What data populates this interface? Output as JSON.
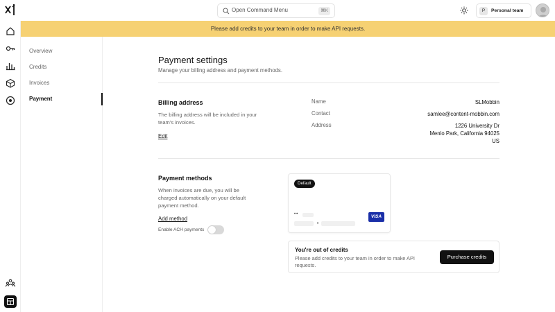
{
  "topbar": {
    "command_menu_placeholder": "Open Command Menu",
    "command_menu_shortcut": "⌘K",
    "team_initial": "P",
    "team_name": "Personal team"
  },
  "banner": {
    "text": "Please add credits to your team in order to make API requests.",
    "color": "#f6d173"
  },
  "rail": {
    "icons": [
      "home-icon",
      "key-icon",
      "bar-chart-icon",
      "cube-icon",
      "target-icon",
      "team-icon",
      "panel-icon"
    ]
  },
  "subnav": {
    "items": [
      {
        "label": "Overview",
        "active": false
      },
      {
        "label": "Credits",
        "active": false
      },
      {
        "label": "Invoices",
        "active": false
      },
      {
        "label": "Payment",
        "active": true
      }
    ]
  },
  "main": {
    "title": "Payment settings",
    "subtitle": "Manage your billing address and payment methods.",
    "billing": {
      "title": "Billing address",
      "description": "The billing address will be included in your team's invoices.",
      "edit_label": "Edit",
      "name_label": "Name",
      "name_value": "SLMobbin",
      "contact_label": "Contact",
      "contact_value": "samlee@content-mobbin.com",
      "address_label": "Address",
      "address_line1": "1226 University Dr",
      "address_line2": "Menlo Park, California 94025",
      "address_line3": "US"
    },
    "payment_methods": {
      "title": "Payment methods",
      "description": "When invoices are due, you will be charged automatically on your default payment method.",
      "add_method_label": "Add method",
      "ach_label": "Enable ACH payments",
      "ach_enabled": false,
      "card": {
        "badge": "Default",
        "masked_prefix": "••",
        "brand": "VISA"
      }
    },
    "credits_notice": {
      "title": "You're out of credits",
      "description": "Please add credits to your team in order to make API requests.",
      "button_label": "Purchase credits"
    }
  }
}
